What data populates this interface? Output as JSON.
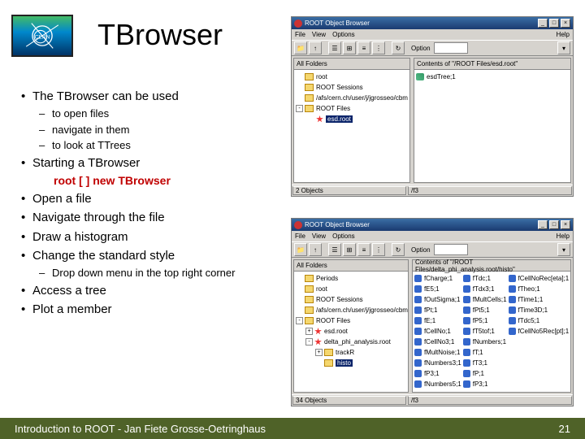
{
  "title": "TBrowser",
  "logo_text": "CERN",
  "bullets": {
    "b1": "The TBrowser can be used",
    "b1a": "to open files",
    "b1b": "navigate in them",
    "b1c": "to look at TTrees",
    "b2": "Starting a TBrowser",
    "code": "root [ ] new TBrowser",
    "b3": "Open a file",
    "b4": "Navigate through the file",
    "b5": "Draw a histogram",
    "b6": "Change the standard style",
    "b6a": "Drop down menu in the top right corner",
    "b7": "Access a tree",
    "b8": "Plot a member"
  },
  "win": {
    "title": "ROOT Object Browser",
    "menu": {
      "file": "File",
      "view": "View",
      "options": "Options",
      "help": "Help"
    },
    "option_label": "Option",
    "left_header": "All Folders",
    "right_header1": "Contents of \"/ROOT Files/esd.root\"",
    "right_header2": "Contents of \"/ROOT Files/delta_phi_analysis.root/histo\"",
    "tree1": {
      "root": "root",
      "sessions": "ROOT Sessions",
      "afs": "/afs/cern.ch/user/j/jgrosseo/cbm",
      "files": "ROOT Files",
      "esd": "esd.root"
    },
    "right1_item": "esdTree;1",
    "tree2": {
      "periods": "Periods",
      "root": "root",
      "sessions": "ROOT Sessions",
      "afs": "/afs/cern.ch/user/j/jgrosseo/cbm",
      "files": "ROOT Files",
      "esd": "esd.root",
      "delta": "delta_phi_analysis.root",
      "track": "trackR",
      "histo": "histo"
    },
    "grid": [
      "fCharge;1",
      "fTdc;1",
      "fCellNoRec[eta];1",
      "fE5;1",
      "fTdx3;1",
      "fTheo;1",
      "fOutSigma;1",
      "fMultCells;1",
      "fTime1;1",
      "fPt;1",
      "fPt5;1",
      "fTime3D;1",
      "fE;1",
      "fP5;1",
      "fTdc5;1",
      "fCellNo;1",
      "fT5tof;1",
      "fCellNo5Rec[pt];1",
      "fCellNo3;1",
      "fNumbers;1",
      "",
      "fMultNoise;1",
      "fT;1",
      "",
      "fNumbers3;1",
      "fT3;1",
      "",
      "fP3;1",
      "fP;1",
      "",
      "fNumbers5;1",
      "fP3;1",
      ""
    ],
    "status1": {
      "objects": "2 Objects",
      "path": "/f3"
    },
    "status2": {
      "objects": "34 Objects",
      "path": "/f3"
    }
  },
  "footer": {
    "text": "Introduction to ROOT - Jan Fiete Grosse-Oetringhaus",
    "page": "21"
  }
}
